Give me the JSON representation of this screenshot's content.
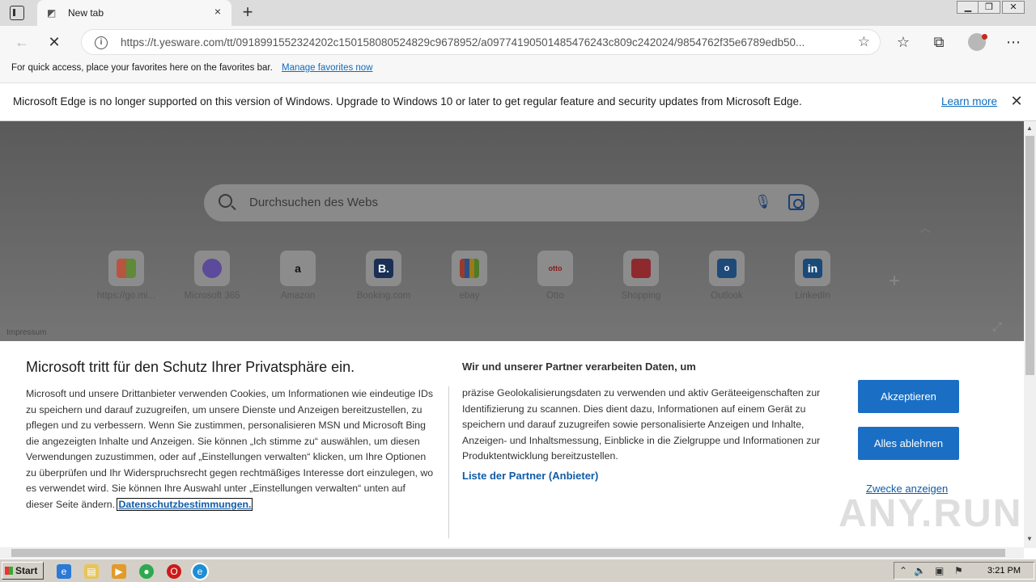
{
  "browser": {
    "tab": {
      "title": "New tab",
      "close_glyph": "×"
    },
    "new_tab_glyph": "+",
    "window_controls": [
      "▭",
      "⧉",
      "✕"
    ],
    "address_bar": {
      "url": "https://t.yesware.com/tt/0918991552324202c150158080524829c9678952/a09774190501485476243c809c242024/9854762f35e6789edb50..."
    },
    "favorites_bar": {
      "text": "For quick access, place your favorites here on the favorites bar.",
      "link": "Manage favorites now"
    },
    "info_bar": {
      "message": "Microsoft Edge is no longer supported on this version of Windows. Upgrade to Windows 10 or later to get regular feature and security updates from Microsoft Edge.",
      "learn_more": "Learn more"
    }
  },
  "newtab": {
    "search_placeholder": "Durchsuchen des Webs",
    "tiles": [
      {
        "label": "https://go.mi...",
        "icon": "microsoft-icon",
        "color": "#f25022"
      },
      {
        "label": "Microsoft 365",
        "icon": "m365-icon",
        "color": "#7b54d6"
      },
      {
        "label": "Amazon",
        "icon": "amazon-icon",
        "color": "#232f3e"
      },
      {
        "label": "Booking.com",
        "icon": "booking-icon",
        "color": "#003580"
      },
      {
        "label": "ebay",
        "icon": "ebay-icon",
        "color": "#e53238"
      },
      {
        "label": "Otto",
        "icon": "otto-icon",
        "color": "#d4021d"
      },
      {
        "label": "Shopping",
        "icon": "shopping-icon",
        "color": "#d13438"
      },
      {
        "label": "Outlook",
        "icon": "outlook-icon",
        "color": "#0f6cbd"
      },
      {
        "label": "LinkedIn",
        "icon": "linkedin-icon",
        "color": "#0a66c2"
      }
    ],
    "impressum": "Impressum"
  },
  "consent": {
    "title": "Microsoft tritt für den Schutz Ihrer Privatsphäre ein.",
    "body": "Microsoft und unsere Drittanbieter verwenden Cookies, um Informationen wie eindeutige IDs zu speichern und darauf zuzugreifen, um unsere Dienste und Anzeigen bereitzustellen, zu pflegen und zu verbessern. Wenn Sie zustimmen, personalisieren MSN und Microsoft Bing die angezeigten Inhalte und Anzeigen. Sie können „Ich stimme zu“ auswählen, um diesen Verwendungen zuzustimmen, oder auf „Einstellungen verwalten“ klicken, um Ihre Optionen zu überprüfen und Ihr Widerspruchsrecht gegen rechtmäßiges Interesse dort einzulegen, wo es verwendet wird.  Sie können Ihre Auswahl unter „Einstellungen verwalten“ unten auf dieser Seite ändern.",
    "privacy_link": "Datenschutzbestimmungen.",
    "partners_heading": "Wir und unserer Partner verarbeiten Daten, um",
    "partners_body": "präzise Geolokalisierungsdaten zu verwenden und aktiv Geräteeigenschaften zur Identifizierung zu scannen. Dies dient dazu, Informationen auf einem Gerät zu speichern und darauf zuzugreifen sowie personalisierte Anzeigen und Inhalte, Anzeigen- und Inhaltsmessung, Einblicke in die Zielgruppe und Informationen zur Produktentwicklung bereitzustellen.",
    "partners_link": "Liste der Partner (Anbieter)",
    "accept": "Akzeptieren",
    "reject": "Alles ablehnen",
    "purposes": "Zwecke anzeigen",
    "watermark": "ANY.RUN"
  },
  "taskbar": {
    "start": "Start",
    "time": "3:21 PM"
  }
}
